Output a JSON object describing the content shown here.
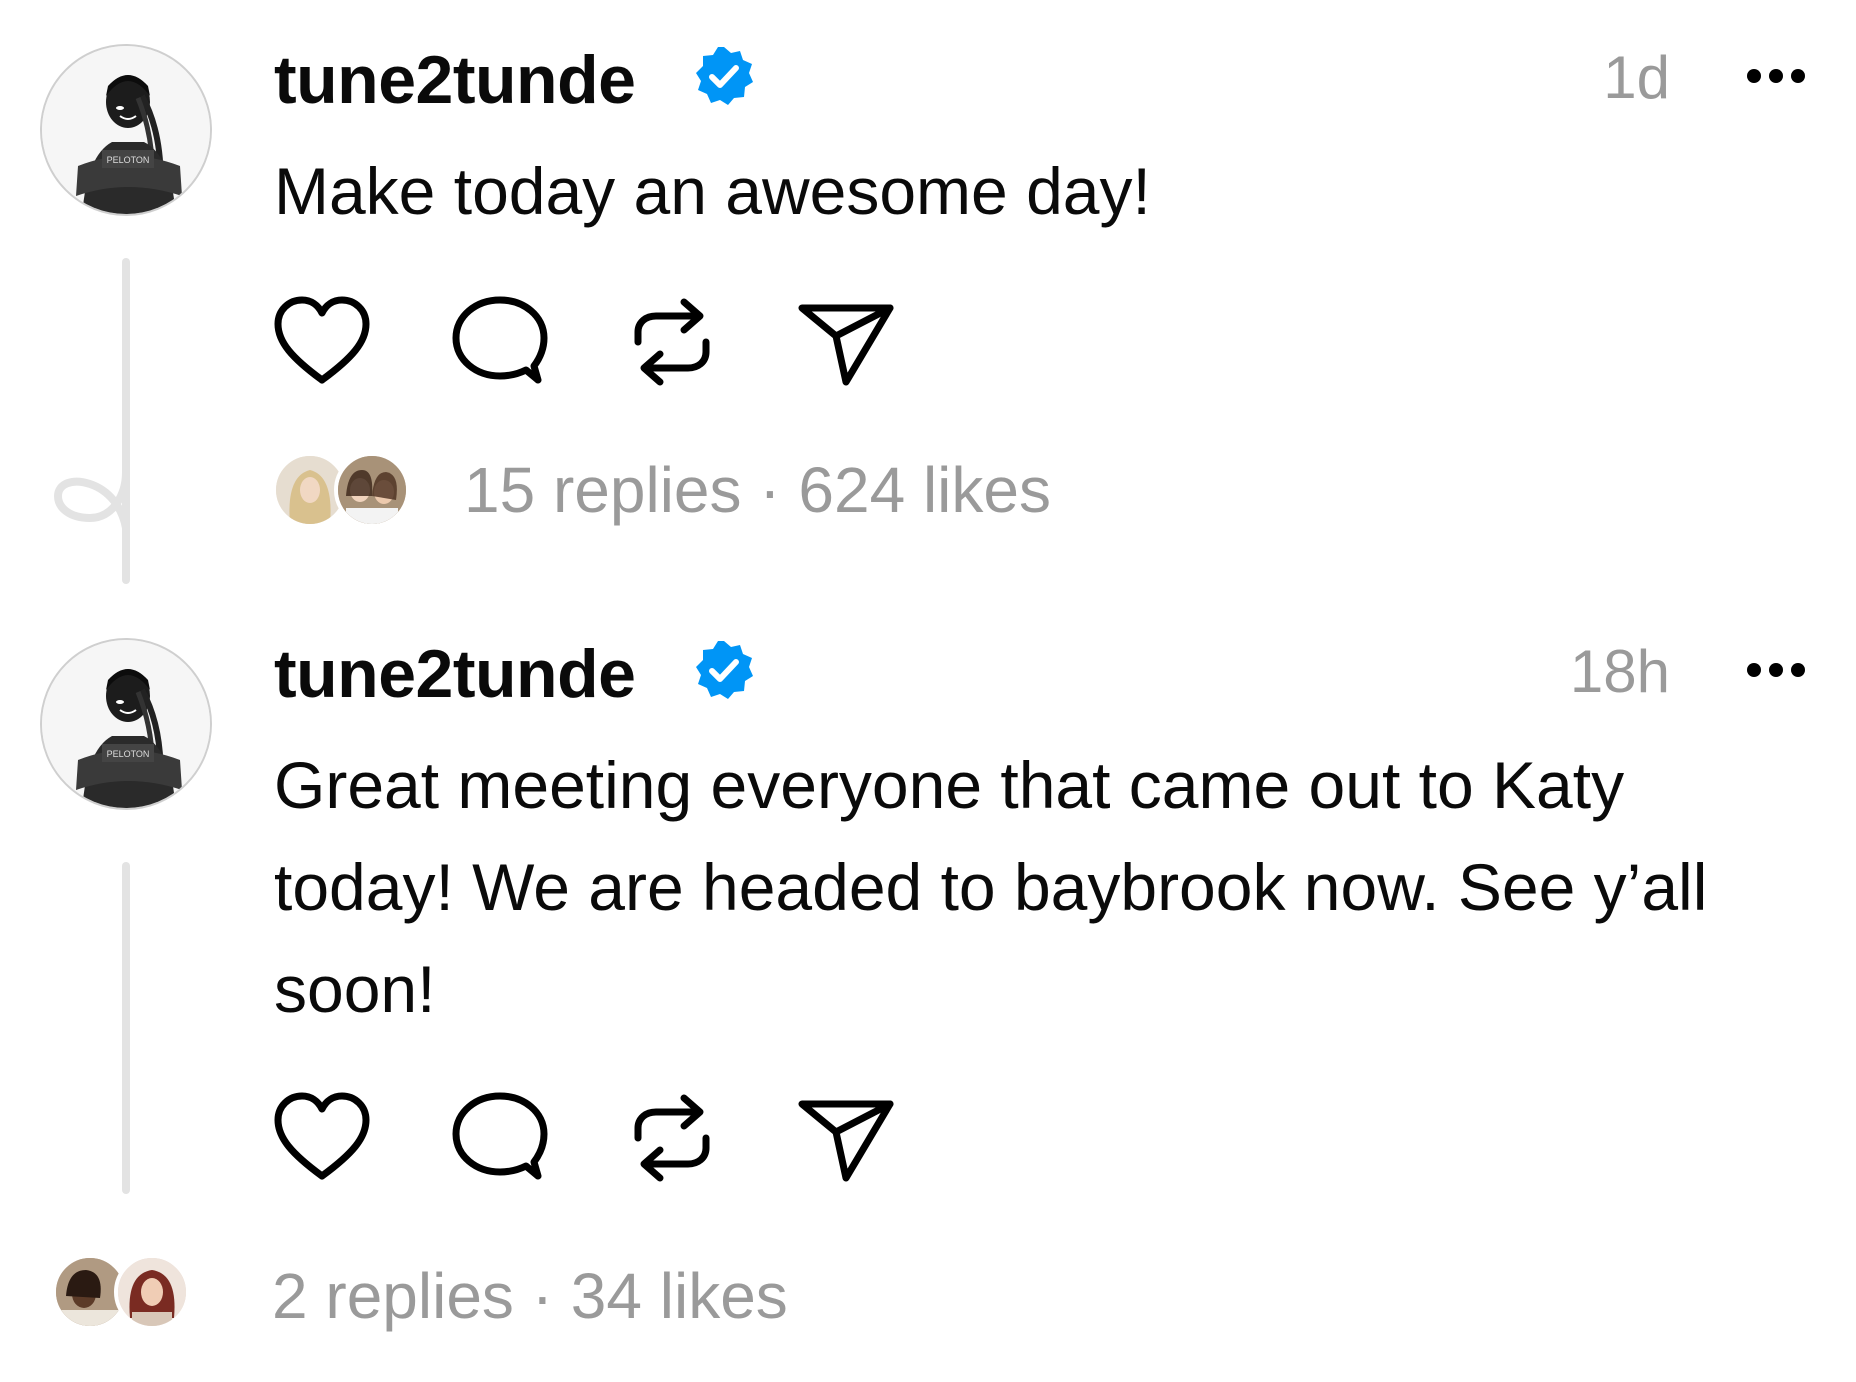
{
  "posts": [
    {
      "username": "tune2tunde",
      "timestamp": "1d",
      "text": "Make today an awesome day!",
      "stats": {
        "replies_label": "15 replies",
        "separator": "·",
        "likes_label": "624 likes"
      },
      "verified": true
    },
    {
      "username": "tune2tunde",
      "timestamp": "18h",
      "text": "Great meeting everyone that came out to Katy today! We are headed to baybrook now. See y’all soon!",
      "stats": {
        "replies_label": "2 replies",
        "separator": "·",
        "likes_label": "34 likes"
      },
      "verified": true
    }
  ],
  "avatar_brand_text": "PELOTON",
  "icons": {
    "actions": [
      "heart-icon",
      "comment-icon",
      "repost-icon",
      "share-icon"
    ],
    "more": "more-horizontal-icon",
    "verified": "verified-badge-icon",
    "thread": "thread-loop-icon"
  },
  "colors": {
    "verified_blue": "#0095f6",
    "muted_text": "#9a9a9a",
    "thread_line": "#e3e3e3",
    "text": "#0a0a0a"
  }
}
